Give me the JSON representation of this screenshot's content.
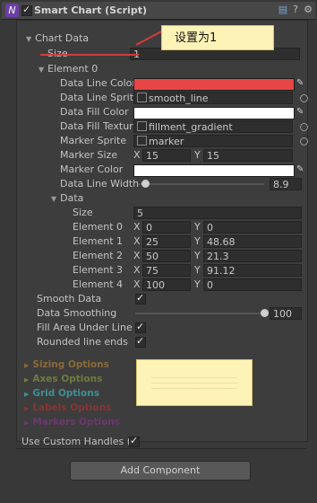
{
  "header": {
    "title": "Smart Chart (Script)",
    "script_icon": "script-icon",
    "buttons": [
      "book-icon",
      "help-icon",
      "gear-icon"
    ]
  },
  "annotation_callout": "设置为1",
  "chart_data_label": "Chart Data",
  "size": {
    "label": "Size",
    "value": "1"
  },
  "element0": {
    "label": "Element 0",
    "line_color": {
      "label": "Data Line Color",
      "color": "#e84646"
    },
    "line_sprite": {
      "label": "Data Line Sprite",
      "value": "smooth_line"
    },
    "fill_color": {
      "label": "Data Fill Color",
      "color": "#ffffff"
    },
    "fill_texture": {
      "label": "Data Fill Texture",
      "value": "fillment_gradient"
    },
    "marker_sprite": {
      "label": "Marker Sprite",
      "value": "marker"
    },
    "marker_size": {
      "label": "Marker Size",
      "x_label": "X",
      "x": "15",
      "y_label": "Y",
      "y": "15"
    },
    "marker_color": {
      "label": "Marker Color",
      "color": "#ffffff"
    },
    "line_width": {
      "label": "Data Line Width",
      "value": "8.9",
      "fraction": 0.05
    },
    "data": {
      "label": "Data",
      "size_label": "Size",
      "size": "5",
      "elements": [
        {
          "label": "Element 0",
          "x": "0",
          "y": "0"
        },
        {
          "label": "Element 1",
          "x": "25",
          "y": "48.68"
        },
        {
          "label": "Element 2",
          "x": "50",
          "y": "21.3"
        },
        {
          "label": "Element 3",
          "x": "75",
          "y": "91.12"
        },
        {
          "label": "Element 4",
          "x": "100",
          "y": "0"
        }
      ]
    }
  },
  "smooth_data": {
    "label": "Smooth Data",
    "checked": true
  },
  "data_smoothing": {
    "label": "Data Smoothing",
    "value": "100",
    "fraction": 1.0
  },
  "fill_area": {
    "label": "Fill Area Under Line",
    "checked": true
  },
  "rounded_ends": {
    "label": "Rounded line ends",
    "checked": true
  },
  "sections": [
    {
      "label": "Sizing Options",
      "color": "#8a6a3a"
    },
    {
      "label": "Axes Options",
      "color": "#6f7a3e"
    },
    {
      "label": "Grid Options",
      "color": "#3f8f96"
    },
    {
      "label": "Labels Options",
      "color": "#8a3434"
    },
    {
      "label": "Markers Options",
      "color": "#6a3a6e"
    }
  ],
  "custom_handles": {
    "label": "Use Custom Handles (e",
    "checked": true
  },
  "add_component": "Add Component"
}
